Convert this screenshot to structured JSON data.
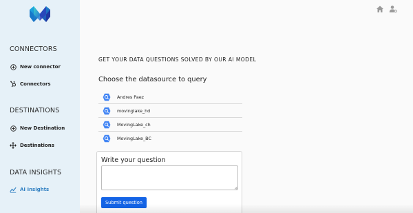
{
  "sidebar": {
    "logo_icon": "brand-logo-icon",
    "sections": [
      {
        "title": "CONNECTORS",
        "items": [
          {
            "label": "New connector",
            "icon": "plus-circle-icon"
          },
          {
            "label": "Connectors",
            "icon": "hubspot-icon"
          }
        ]
      },
      {
        "title": "DESTINATIONS",
        "items": [
          {
            "label": "New Destination",
            "icon": "plus-circle-icon"
          },
          {
            "label": "Destinations",
            "icon": "move-arrows-icon"
          }
        ]
      },
      {
        "title": "DATA INSIGHTS",
        "items": [
          {
            "label": "AI Insights",
            "icon": "chart-line-icon",
            "active": true
          }
        ]
      }
    ]
  },
  "topbar": {
    "icons": [
      "home-icon",
      "user-settings-icon"
    ]
  },
  "main": {
    "headline": "GET YOUR DATA QUESTIONS SOLVED BY OUR AI MODEL",
    "subhead": "Choose the datasource to query",
    "datasources": [
      {
        "label": "Andres Paez",
        "icon": "bigquery-icon"
      },
      {
        "label": "movinglake_hd",
        "icon": "bigquery-icon"
      },
      {
        "label": "MovingLake_ch",
        "icon": "bigquery-icon"
      },
      {
        "label": "MovingLake_BC",
        "icon": "bigquery-icon"
      }
    ],
    "question_card": {
      "title": "Write your question",
      "input_value": "",
      "submit_label": "Submit question"
    }
  },
  "colors": {
    "sidebar_bg": "#e6f1f8",
    "accent": "#2f7fc1",
    "button": "#1464e6",
    "bigquery": "#4285f4"
  }
}
